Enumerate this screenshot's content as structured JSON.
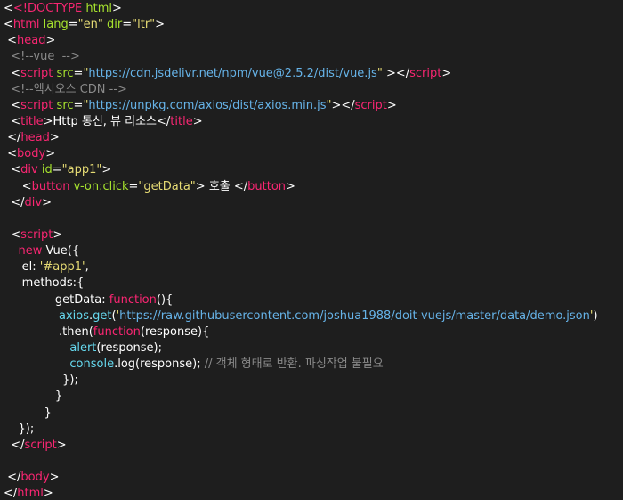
{
  "editor": {
    "background": "#1e1e1e",
    "token_colors": {
      "tag": "#f92672",
      "attribute": "#a6e22e",
      "string": "#e6db74",
      "url": "#66b3e8",
      "comment": "#8a8a8a",
      "keyword": "#f92672",
      "function": "#66d9ef",
      "text": "#ffffff"
    },
    "lines": [
      [
        [
          "punct",
          "<"
        ],
        [
          "tag",
          "<!DOCTYPE"
        ],
        [
          "txt",
          " "
        ],
        [
          "attr",
          "html"
        ],
        [
          "punct",
          ">"
        ]
      ],
      [
        [
          "punct",
          "<"
        ],
        [
          "tag",
          "html"
        ],
        [
          "txt",
          " "
        ],
        [
          "attr",
          "lang"
        ],
        [
          "punct",
          "="
        ],
        [
          "str",
          "\"en\""
        ],
        [
          "txt",
          " "
        ],
        [
          "attr",
          "dir"
        ],
        [
          "punct",
          "="
        ],
        [
          "str",
          "\"ltr\""
        ],
        [
          "punct",
          ">"
        ]
      ],
      [
        [
          "txt",
          " "
        ],
        [
          "punct",
          "<"
        ],
        [
          "tag",
          "head"
        ],
        [
          "punct",
          ">"
        ]
      ],
      [
        [
          "txt",
          "  "
        ],
        [
          "cmt",
          "<!--vue  -->"
        ]
      ],
      [
        [
          "txt",
          "  "
        ],
        [
          "punct",
          "<"
        ],
        [
          "tag",
          "script"
        ],
        [
          "txt",
          " "
        ],
        [
          "attr",
          "src"
        ],
        [
          "punct",
          "="
        ],
        [
          "str",
          "\""
        ],
        [
          "url",
          "https://cdn.jsdelivr.net/npm/vue@2.5.2/dist/vue.js"
        ],
        [
          "str",
          "\""
        ],
        [
          "txt",
          " "
        ],
        [
          "punct",
          "></"
        ],
        [
          "tag",
          "script"
        ],
        [
          "punct",
          ">"
        ]
      ],
      [
        [
          "txt",
          "  "
        ],
        [
          "cmt",
          "<!--엑시오스 CDN -->"
        ]
      ],
      [
        [
          "txt",
          "  "
        ],
        [
          "punct",
          "<"
        ],
        [
          "tag",
          "script"
        ],
        [
          "txt",
          " "
        ],
        [
          "attr",
          "src"
        ],
        [
          "punct",
          "="
        ],
        [
          "str",
          "\""
        ],
        [
          "url",
          "https://unpkg.com/axios/dist/axios.min.js"
        ],
        [
          "str",
          "\""
        ],
        [
          "punct",
          "></"
        ],
        [
          "tag",
          "script"
        ],
        [
          "punct",
          ">"
        ]
      ],
      [
        [
          "txt",
          "  "
        ],
        [
          "punct",
          "<"
        ],
        [
          "tag",
          "title"
        ],
        [
          "punct",
          ">"
        ],
        [
          "txt",
          "Http 통신, 뷰 리소스"
        ],
        [
          "punct",
          "</"
        ],
        [
          "tag",
          "title"
        ],
        [
          "punct",
          ">"
        ]
      ],
      [
        [
          "txt",
          " "
        ],
        [
          "punct",
          "</"
        ],
        [
          "tag",
          "head"
        ],
        [
          "punct",
          ">"
        ]
      ],
      [
        [
          "txt",
          " "
        ],
        [
          "punct",
          "<"
        ],
        [
          "tag",
          "body"
        ],
        [
          "punct",
          ">"
        ]
      ],
      [
        [
          "txt",
          "  "
        ],
        [
          "punct",
          "<"
        ],
        [
          "tag",
          "div"
        ],
        [
          "txt",
          " "
        ],
        [
          "attr",
          "id"
        ],
        [
          "punct",
          "="
        ],
        [
          "str",
          "\"app1\""
        ],
        [
          "punct",
          ">"
        ]
      ],
      [
        [
          "txt",
          "     "
        ],
        [
          "punct",
          "<"
        ],
        [
          "tag",
          "button"
        ],
        [
          "txt",
          " "
        ],
        [
          "attr",
          "v-on:click"
        ],
        [
          "punct",
          "="
        ],
        [
          "str",
          "\"getData\""
        ],
        [
          "punct",
          ">"
        ],
        [
          "txt",
          " 호출 "
        ],
        [
          "punct",
          "</"
        ],
        [
          "tag",
          "button"
        ],
        [
          "punct",
          ">"
        ]
      ],
      [
        [
          "txt",
          "  "
        ],
        [
          "punct",
          "</"
        ],
        [
          "tag",
          "div"
        ],
        [
          "punct",
          ">"
        ]
      ],
      [
        [
          "txt",
          ""
        ]
      ],
      [
        [
          "txt",
          "  "
        ],
        [
          "punct",
          "<"
        ],
        [
          "tag",
          "script"
        ],
        [
          "punct",
          ">"
        ]
      ],
      [
        [
          "txt",
          "    "
        ],
        [
          "kw",
          "new"
        ],
        [
          "txt",
          " Vue({"
        ]
      ],
      [
        [
          "txt",
          "     el: "
        ],
        [
          "str",
          "'#app1'"
        ],
        [
          "txt",
          ","
        ]
      ],
      [
        [
          "txt",
          "     methods:{"
        ]
      ],
      [
        [
          "txt",
          "              getData: "
        ],
        [
          "kw",
          "function"
        ],
        [
          "txt",
          "(){"
        ]
      ],
      [
        [
          "txt",
          "               "
        ],
        [
          "fn",
          "axios"
        ],
        [
          "txt",
          "."
        ],
        [
          "fn",
          "get"
        ],
        [
          "txt",
          "("
        ],
        [
          "str",
          "'"
        ],
        [
          "url",
          "https://raw.githubusercontent.com/joshua1988/doit-vuejs/master/data/demo.json"
        ],
        [
          "str",
          "'"
        ],
        [
          "txt",
          ")"
        ]
      ],
      [
        [
          "txt",
          "               .then("
        ],
        [
          "kw",
          "function"
        ],
        [
          "txt",
          "(response){"
        ]
      ],
      [
        [
          "txt",
          "                  "
        ],
        [
          "fn",
          "alert"
        ],
        [
          "txt",
          "(response);"
        ]
      ],
      [
        [
          "txt",
          "                  "
        ],
        [
          "fn",
          "console"
        ],
        [
          "txt",
          ".log(response); "
        ],
        [
          "cmt",
          "// 객체 형태로 반환. 파싱작업 불필요"
        ]
      ],
      [
        [
          "txt",
          "                });"
        ]
      ],
      [
        [
          "txt",
          "              }"
        ]
      ],
      [
        [
          "txt",
          "           }"
        ]
      ],
      [
        [
          "txt",
          "    });"
        ]
      ],
      [
        [
          "txt",
          "  "
        ],
        [
          "punct",
          "</"
        ],
        [
          "tag",
          "script"
        ],
        [
          "punct",
          ">"
        ]
      ],
      [
        [
          "txt",
          ""
        ]
      ],
      [
        [
          "txt",
          " "
        ],
        [
          "punct",
          "</"
        ],
        [
          "tag",
          "body"
        ],
        [
          "punct",
          ">"
        ]
      ],
      [
        [
          "punct",
          "</"
        ],
        [
          "tag",
          "html"
        ],
        [
          "punct",
          ">"
        ]
      ]
    ]
  }
}
